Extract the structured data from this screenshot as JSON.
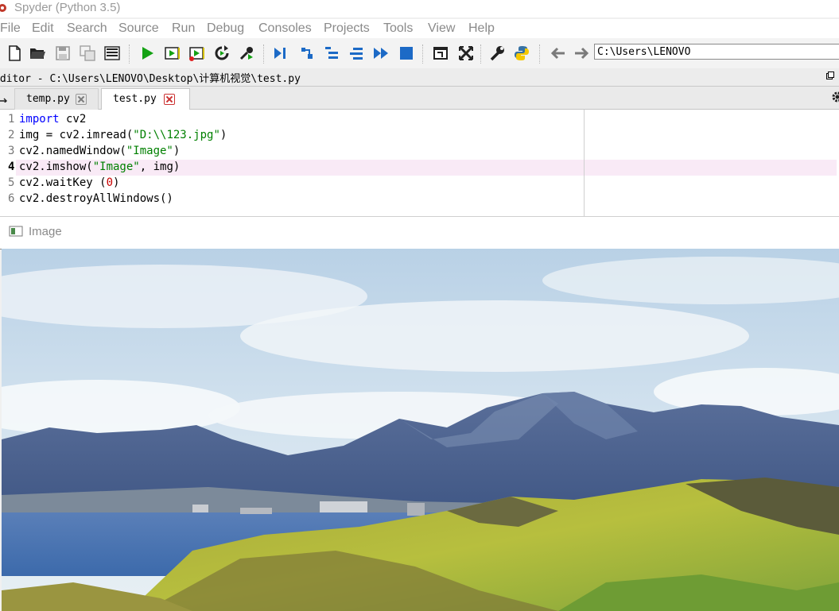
{
  "window": {
    "title": "Spyder (Python 3.5)"
  },
  "menu": [
    "File",
    "Edit",
    "Search",
    "Source",
    "Run",
    "Debug",
    "Consoles",
    "Projects",
    "Tools",
    "View",
    "Help"
  ],
  "toolbar": {
    "working_directory": "C:\\Users\\LENOVO",
    "icons": [
      "new-file-icon",
      "open-folder-icon",
      "save-icon",
      "save-all-icon",
      "outline-icon",
      "run-icon",
      "run-cell-icon",
      "run-cell-advance-icon",
      "rerun-icon",
      "configure-run-icon",
      "debug-icon",
      "step-icon",
      "step-into-icon",
      "step-return-icon",
      "continue-icon",
      "stop-icon",
      "maximize-pane-icon",
      "fullscreen-icon",
      "preferences-icon",
      "python-path-icon",
      "back-arrow-icon",
      "forward-arrow-icon"
    ]
  },
  "editor": {
    "title": "Editor - C:\\Users\\LENOVO\\Desktop\\计算机视觉\\test.py",
    "tabs": [
      {
        "label": "temp.py",
        "active": false
      },
      {
        "label": "test.py",
        "active": true
      }
    ],
    "current_line": 4,
    "lines": [
      {
        "num": "1",
        "tokens": [
          {
            "t": "import",
            "c": "kw"
          },
          {
            "t": " cv2",
            "c": ""
          }
        ]
      },
      {
        "num": "2",
        "tokens": [
          {
            "t": "img = cv2.imread(",
            "c": ""
          },
          {
            "t": "\"D:\\\\123.jpg\"",
            "c": "str"
          },
          {
            "t": ")",
            "c": ""
          }
        ]
      },
      {
        "num": "3",
        "tokens": [
          {
            "t": "cv2.namedWindow(",
            "c": ""
          },
          {
            "t": "\"Image\"",
            "c": "str"
          },
          {
            "t": ")",
            "c": ""
          }
        ]
      },
      {
        "num": "4",
        "tokens": [
          {
            "t": "cv2.imshow(",
            "c": ""
          },
          {
            "t": "\"Image\"",
            "c": "str"
          },
          {
            "t": ", img)",
            "c": ""
          }
        ]
      },
      {
        "num": "5",
        "tokens": [
          {
            "t": "cv2.waitKey (",
            "c": ""
          },
          {
            "t": "0",
            "c": "num"
          },
          {
            "t": ")",
            "c": ""
          }
        ]
      },
      {
        "num": "6",
        "tokens": [
          {
            "t": "cv2.destroyAllWindows()",
            "c": ""
          }
        ]
      }
    ]
  },
  "image_window": {
    "title": "Image"
  },
  "colors": {
    "keyword": "#0000ff",
    "string": "#008000",
    "number": "#c80000",
    "current_line_bg": "#f9eaf6"
  }
}
